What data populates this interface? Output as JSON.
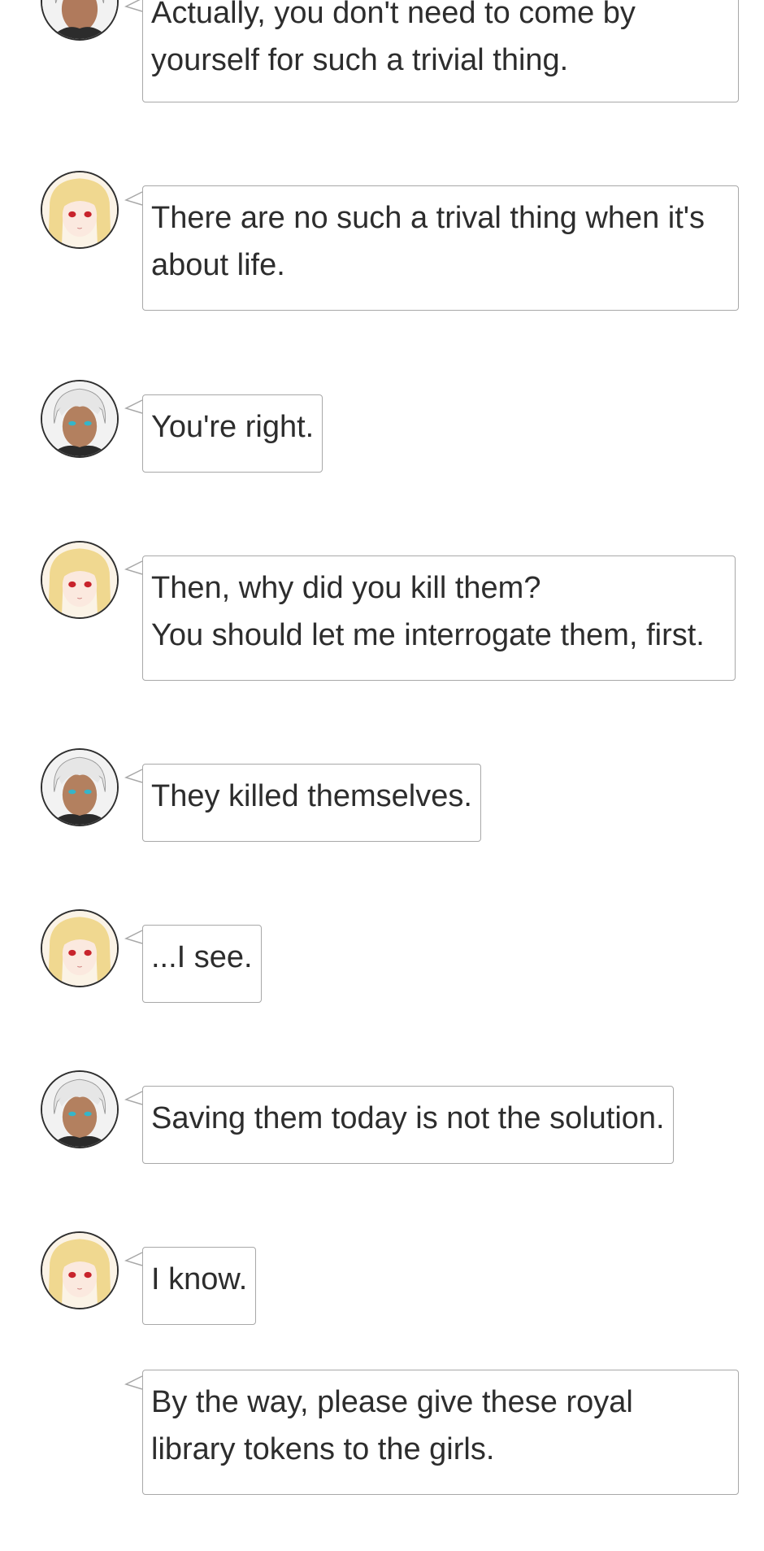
{
  "messages": [
    {
      "speaker": "dark-skinned-man",
      "text": "Actually, you don't need to come by\nyourself for such a trivial thing."
    },
    {
      "speaker": "blonde-girl",
      "text": "There are no such a trival thing when it's\nabout life."
    },
    {
      "speaker": "dark-skinned-man",
      "text": "You're right."
    },
    {
      "speaker": "blonde-girl",
      "text": "Then, why did you kill them?\nYou should let me interrogate them, first."
    },
    {
      "speaker": "dark-skinned-man",
      "text": "They killed themselves."
    },
    {
      "speaker": "blonde-girl",
      "text": "...I see."
    },
    {
      "speaker": "dark-skinned-man",
      "text": "Saving them today is not the solution."
    },
    {
      "speaker": "blonde-girl",
      "text": "I know."
    },
    {
      "speaker": "blonde-girl",
      "text": "By the way, please give these royal\nlibrary tokens to the girls."
    }
  ]
}
